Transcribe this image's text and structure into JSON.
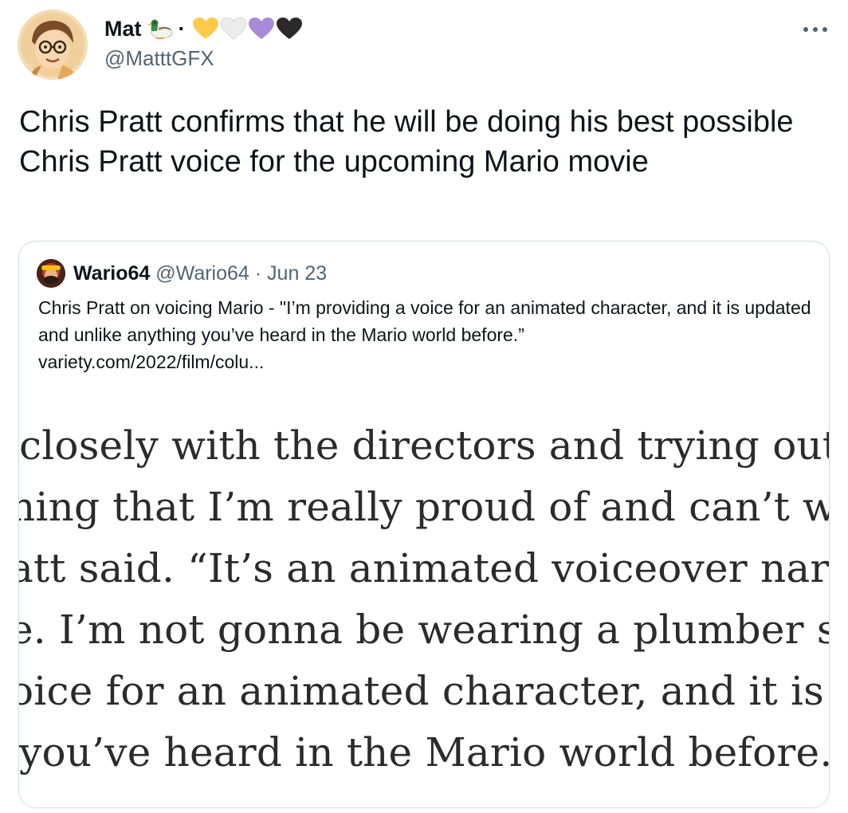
{
  "author": {
    "name": "Mat",
    "separator": "·",
    "handle": "@MatttGFX"
  },
  "tweet": {
    "text": "Chris Pratt confirms that he will be doing his best possible Chris Pratt voice for the upcoming Mario movie"
  },
  "quoted": {
    "name": "Wario64",
    "handle": "@Wario64",
    "date": "· Jun 23",
    "text": "Chris Pratt on voicing Mario - \"I’m providing a voice for an animated character, and it is updated and unlike anything you’ve heard in the Mario world before.”",
    "link": "variety.com/2022/film/colu...",
    "image_lines": [
      "closely with the directors and trying out a f",
      "hing that I’m really proud of and can’t wait",
      "att said. “It’s an animated voiceover narrat",
      "e. I’m not gonna be wearing a plumber suit",
      "oice for an animated character, and it is up",
      "you’ve heard in the Mario world before.”"
    ]
  },
  "icons": {
    "more": "more-horizontal-icon",
    "duck": "duck-emoji-icon",
    "hearts": [
      "yellow-heart-icon",
      "white-heart-icon",
      "purple-heart-icon",
      "black-heart-icon"
    ]
  },
  "colors": {
    "text": "#0f1419",
    "secondary": "#536471",
    "border": "#cfd9de",
    "yellow_heart": "#ffca4b",
    "white_heart": "#ececec",
    "purple_heart": "#a98ad8",
    "black_heart": "#2a2a2a"
  }
}
